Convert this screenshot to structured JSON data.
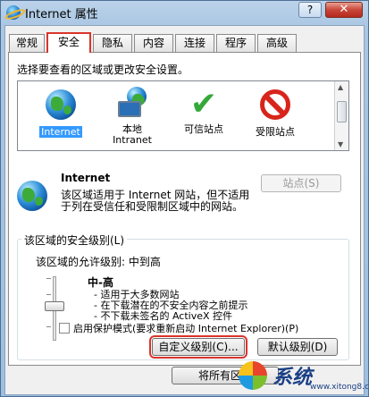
{
  "window": {
    "title": "Internet 属性",
    "help_label": "?",
    "close_label": "✕"
  },
  "tabs": [
    {
      "label": "常规"
    },
    {
      "label": "安全",
      "active": true
    },
    {
      "label": "隐私"
    },
    {
      "label": "内容"
    },
    {
      "label": "连接"
    },
    {
      "label": "程序"
    },
    {
      "label": "高级"
    }
  ],
  "security": {
    "instruction": "选择要查看的区域或更改安全设置。",
    "zones": [
      {
        "label": "Internet",
        "icon": "globe-icon",
        "selected": true
      },
      {
        "label": "本地\nIntranet",
        "icon": "intranet-icon"
      },
      {
        "label": "可信站点",
        "icon": "checkmark-icon"
      },
      {
        "label": "受限站点",
        "icon": "restricted-icon"
      }
    ],
    "selected_zone_name": "Internet",
    "selected_zone_desc": "该区域适用于 Internet 网站，但不适用于列在受信任和受限制区域中的网站。",
    "sites_button": "站点(S)",
    "level_group_title": "该区域的安全级别(L)",
    "allowed_levels": "该区域的允许级别: 中到高",
    "level_name": "中-高",
    "level_desc": [
      "- 适用于大多数网站",
      "- 在下载潜在的不安全内容之前提示",
      "- 不下载未签名的 ActiveX 控件"
    ],
    "slider_level": "中-高",
    "protected_mode_label": "启用保护模式(要求重新启动 Internet Explorer)(P)",
    "protected_mode_checked": false,
    "custom_level_button": "自定义级别(C)...",
    "default_level_button": "默认级别(D)",
    "reset_all_button": "将所有区域"
  },
  "watermark": {
    "text": "系统",
    "url": "www.xitong8.com"
  },
  "colors": {
    "highlight_border": "#d9342b",
    "selection": "#3399ff"
  }
}
